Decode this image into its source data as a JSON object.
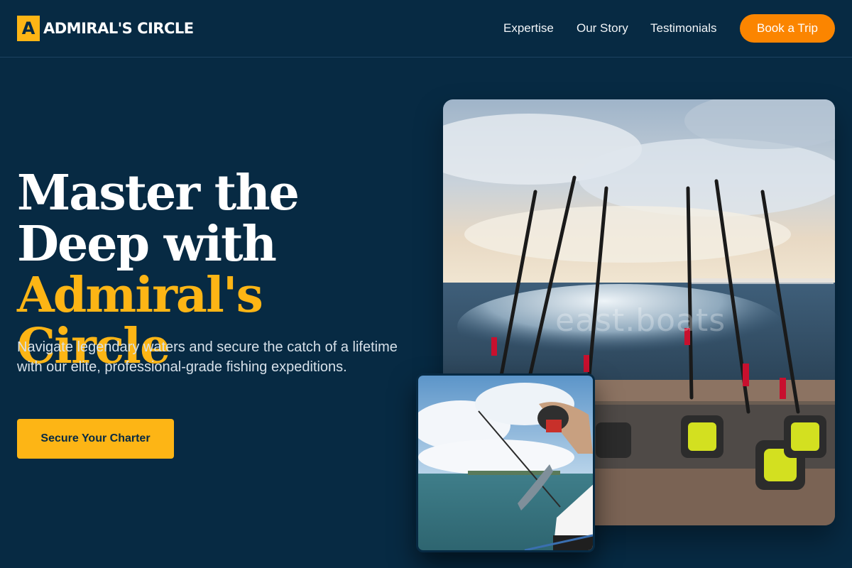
{
  "brand": {
    "mark": "A",
    "name": "ADMIRAL'S CIRCLE"
  },
  "nav": {
    "items": [
      "Expertise",
      "Our Story",
      "Testimonials"
    ],
    "cta": "Book a Trip"
  },
  "hero": {
    "title_plain": "Master the Deep with",
    "title_accent": "Admiral's Circle",
    "subtitle": "Navigate legendary waters and secure the catch of a lifetime with our elite, professional-grade fishing expeditions.",
    "cta": "Secure Your Charter"
  },
  "images": {
    "main_watermark": "east.boats"
  },
  "colors": {
    "background": "#072a43",
    "accent": "#fdb515",
    "book_button": "#fb8500"
  }
}
